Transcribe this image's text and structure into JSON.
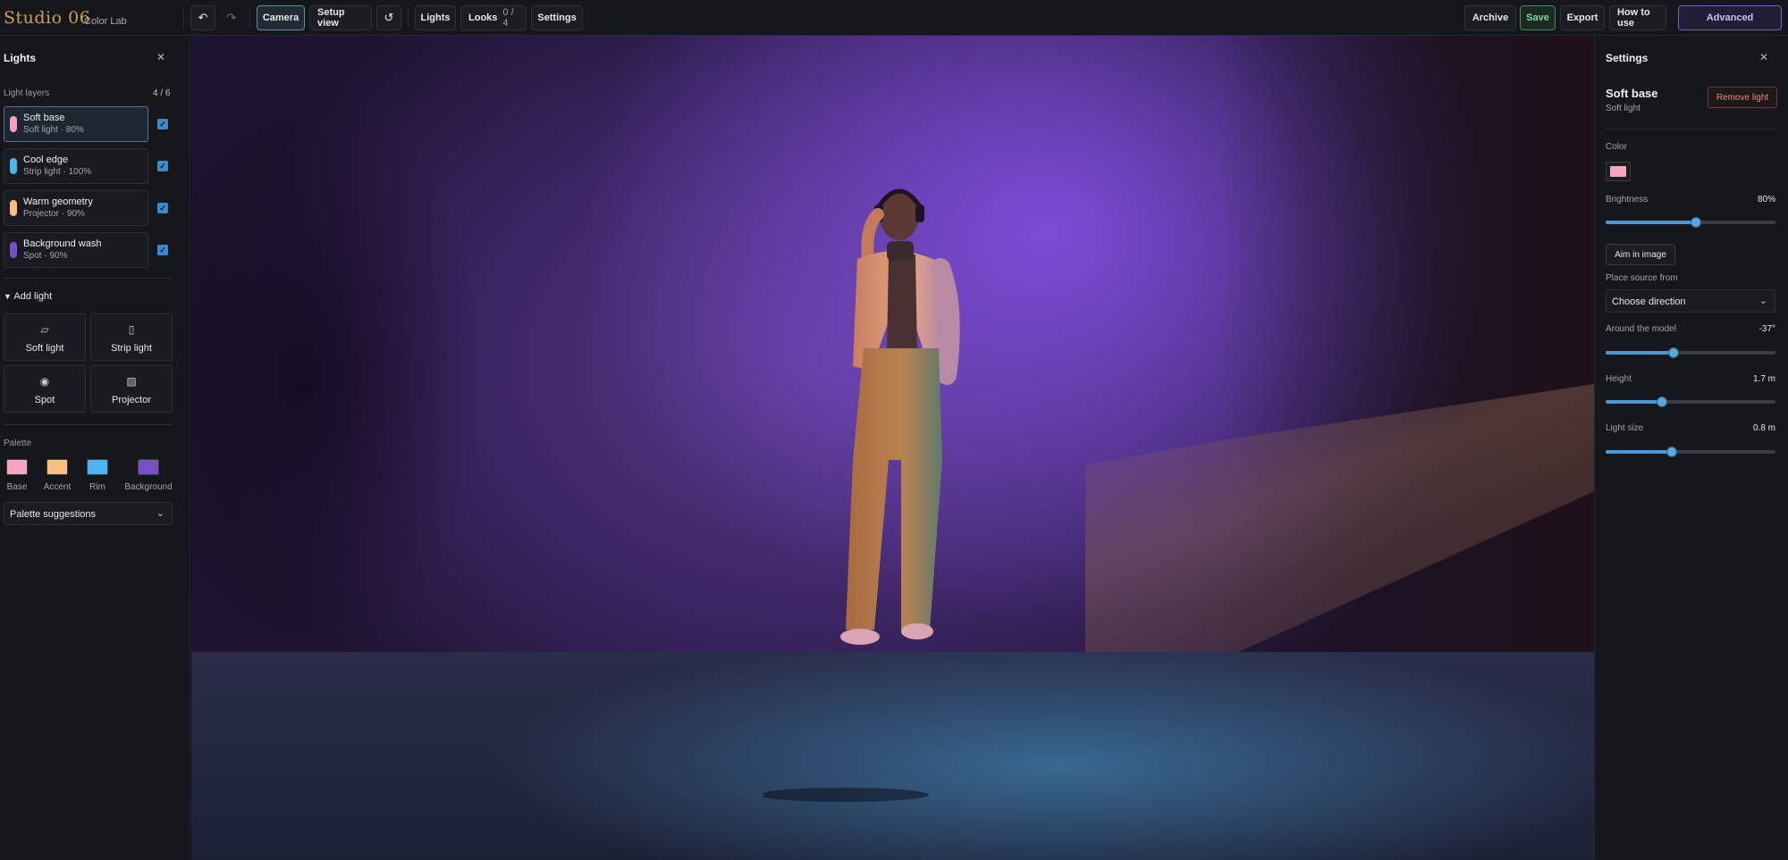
{
  "app": {
    "name": "Studio 06",
    "subtitle": "Color Lab"
  },
  "toolbar": {
    "undo_icon": "undo-icon",
    "redo_icon": "redo-icon",
    "camera_label": "Camera",
    "setup_view_label": "Setup view",
    "reset_icon": "refresh-icon",
    "lights_label": "Lights",
    "looks_label": "Looks",
    "looks_count": "0 / 4",
    "settings_label": "Settings",
    "archive_label": "Archive",
    "save_label": "Save",
    "export_label": "Export",
    "howto_label": "How to use",
    "advanced_label": "Advanced"
  },
  "lights_panel": {
    "title": "Lights",
    "layers_label": "Light layers",
    "layers_count": "4 / 6",
    "layers": [
      {
        "name": "Soft base",
        "meta": "Soft light · 80%",
        "color": "#f2a0bd",
        "checked": true,
        "selected": true
      },
      {
        "name": "Cool edge",
        "meta": "Strip light · 100%",
        "color": "#4ab5f0",
        "checked": true,
        "selected": false
      },
      {
        "name": "Warm geometry",
        "meta": "Projector · 90%",
        "color": "#f6c07a",
        "checked": true,
        "selected": false
      },
      {
        "name": "Background wash",
        "meta": "Spot · 90%",
        "color": "#7550c8",
        "checked": true,
        "selected": false
      }
    ],
    "add_light_label": "Add light",
    "add_types": [
      {
        "label": "Soft light",
        "icon": "soft-light-icon"
      },
      {
        "label": "Strip light",
        "icon": "strip-light-icon"
      },
      {
        "label": "Spot",
        "icon": "spot-icon"
      },
      {
        "label": "Projector",
        "icon": "projector-icon"
      }
    ],
    "palette_label": "Palette",
    "palette": [
      {
        "label": "Base",
        "color": "#f5a6c0"
      },
      {
        "label": "Accent",
        "color": "#f8c27e"
      },
      {
        "label": "Rim",
        "color": "#4ab5f0"
      },
      {
        "label": "Background",
        "color": "#7650c6"
      }
    ],
    "palette_suggestions_label": "Palette suggestions"
  },
  "settings_panel": {
    "title": "Settings",
    "light_name": "Soft base",
    "light_type": "Soft light",
    "remove_label": "Remove light",
    "color_label": "Color",
    "color_value": "#f5a6c0",
    "brightness_label": "Brightness",
    "brightness_value": "80%",
    "brightness_fraction": 0.53,
    "aim_label": "Aim in image",
    "place_source_label": "Place source from",
    "place_source_value": "Choose direction",
    "around_label": "Around the model",
    "around_value": "-37°",
    "around_fraction": 0.4,
    "height_label": "Height",
    "height_value": "1.7 m",
    "height_fraction": 0.33,
    "size_label": "Light size",
    "size_value": "0.8 m",
    "size_fraction": 0.39
  }
}
